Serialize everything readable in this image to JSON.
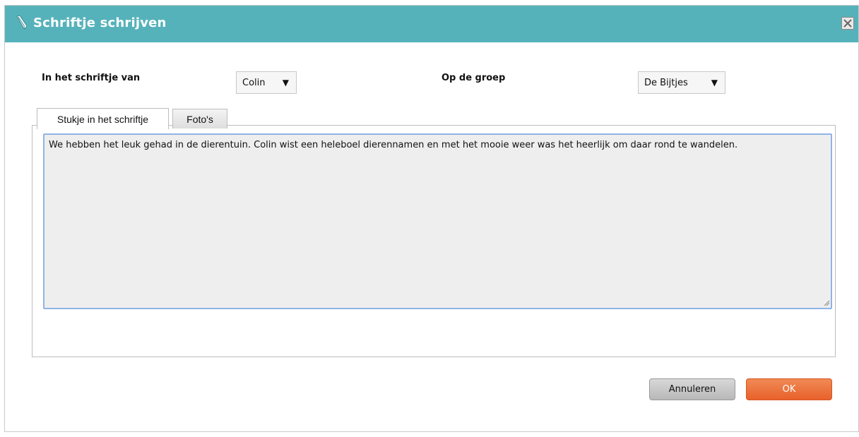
{
  "dialog": {
    "title": "Schriftje schrijven",
    "title_icon": "pencil-icon",
    "close_icon": "close-icon"
  },
  "form": {
    "child_label": "In het schriftje van",
    "child_value": "Colin",
    "group_label": "Op de groep",
    "group_value": "De Bijtjes",
    "dropdown_icon": "triangle-down-icon"
  },
  "tabs": [
    {
      "label": "Stukje in het schriftje",
      "active": true
    },
    {
      "label": "Foto's",
      "active": false
    }
  ],
  "editor": {
    "text": "We hebben het leuk gehad in de dierentuin. Colin wist een heleboel dierennamen en met het mooie weer was het heerlijk om daar rond te wandelen."
  },
  "buttons": {
    "cancel_label": "Annuleren",
    "ok_label": "OK"
  },
  "colors": {
    "titlebar": "#56b2ba",
    "ok_button": "#e8612b",
    "focus_border": "#8fb4e6"
  }
}
